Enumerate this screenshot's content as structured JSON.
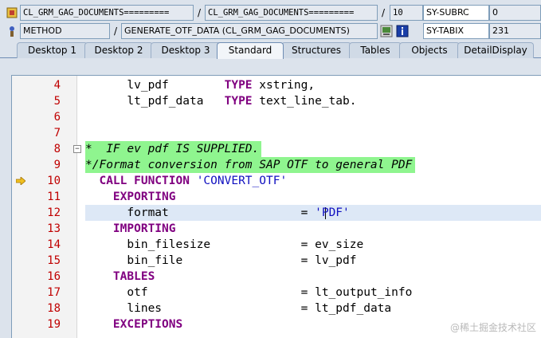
{
  "header": {
    "row1": {
      "program": "CL_GRM_GAG_DOCUMENTS=========",
      "include": "CL_GRM_GAG_DOCUMENTS=========",
      "line": "10",
      "sysfield1_name": "SY-SUBRC",
      "sysfield1_value": "0"
    },
    "row2": {
      "event_type": "METHOD",
      "event_name": "GENERATE_OTF_DATA (CL_GRM_GAG_DOCUMENTS)",
      "sysfield2_name": "SY-TABIX",
      "sysfield2_value": "231"
    },
    "separator": "/"
  },
  "tabs": [
    {
      "label": "Desktop 1",
      "active": false
    },
    {
      "label": "Desktop 2",
      "active": false
    },
    {
      "label": "Desktop 3",
      "active": false
    },
    {
      "label": "Standard",
      "active": true
    },
    {
      "label": "Structures",
      "active": false
    },
    {
      "label": "Tables",
      "active": false
    },
    {
      "label": "Objects",
      "active": false
    },
    {
      "label": "DetailDisplay",
      "active": false
    }
  ],
  "code_lines": [
    {
      "num": "4",
      "indent": "      ",
      "tokens": [
        [
          "lv_pdf        ",
          ""
        ],
        [
          "TYPE",
          "kw"
        ],
        [
          " xstring,",
          ""
        ]
      ]
    },
    {
      "num": "5",
      "indent": "      ",
      "tokens": [
        [
          "lt_pdf_data   ",
          ""
        ],
        [
          "TYPE",
          "kw"
        ],
        [
          " text_line_tab.",
          ""
        ]
      ]
    },
    {
      "num": "6",
      "indent": "",
      "tokens": []
    },
    {
      "num": "7",
      "indent": "",
      "tokens": []
    },
    {
      "num": "8",
      "indent": "",
      "tokens": [
        [
          "*  IF ev pdf IS SUPPLIED.",
          "cmt"
        ]
      ],
      "comment": true
    },
    {
      "num": "9",
      "indent": "",
      "tokens": [
        [
          "*/Format conversion from SAP OTF to general PDF",
          "cmt"
        ]
      ],
      "comment": true
    },
    {
      "num": "10",
      "indent": "  ",
      "tokens": [
        [
          "CALL FUNCTION",
          "kw"
        ],
        [
          " ",
          ""
        ],
        [
          "'CONVERT_OTF'",
          "str"
        ]
      ],
      "current": true
    },
    {
      "num": "11",
      "indent": "    ",
      "tokens": [
        [
          "EXPORTING",
          "kw"
        ]
      ]
    },
    {
      "num": "12",
      "indent": "      ",
      "tokens": [
        [
          "format                   ",
          ""
        ],
        [
          "= ",
          ""
        ],
        [
          "'PDF'",
          "str"
        ]
      ],
      "cursor": true
    },
    {
      "num": "13",
      "indent": "    ",
      "tokens": [
        [
          "IMPORTING",
          "kw"
        ]
      ]
    },
    {
      "num": "14",
      "indent": "      ",
      "tokens": [
        [
          "bin_filesize             ",
          ""
        ],
        [
          "= ev_size",
          ""
        ]
      ]
    },
    {
      "num": "15",
      "indent": "      ",
      "tokens": [
        [
          "bin_file                 ",
          ""
        ],
        [
          "= lv_pdf",
          ""
        ]
      ]
    },
    {
      "num": "16",
      "indent": "    ",
      "tokens": [
        [
          "TABLES",
          "kw"
        ]
      ]
    },
    {
      "num": "17",
      "indent": "      ",
      "tokens": [
        [
          "otf                      ",
          ""
        ],
        [
          "= lt_output_info",
          ""
        ]
      ]
    },
    {
      "num": "18",
      "indent": "      ",
      "tokens": [
        [
          "lines                    ",
          ""
        ],
        [
          "= lt_pdf_data",
          ""
        ]
      ]
    },
    {
      "num": "19",
      "indent": "    ",
      "tokens": [
        [
          "EXCEPTIONS",
          "kw"
        ]
      ]
    }
  ],
  "watermark": "@稀土掘金技术社区",
  "colors": {
    "comment_highlight": "#8ff58f",
    "keyword": "#800080",
    "string": "#1010c0",
    "line_number": "#c00000"
  }
}
